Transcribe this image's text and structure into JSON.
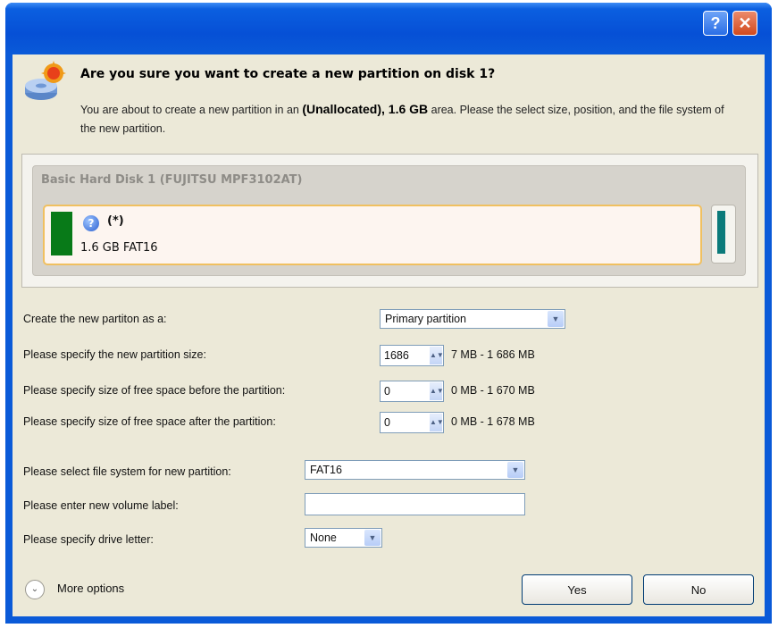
{
  "window": {
    "help_glyph": "?",
    "close_glyph": "✕"
  },
  "header": {
    "title": "Are you sure you want to create a new partition on disk 1?",
    "desc_before": "You are about to create a new partition in an ",
    "desc_bold": "(Unallocated), 1.6 GB",
    "desc_after": " area. Please the select size, position, and the file system of the new partition.",
    "icon": "disk-add-icon"
  },
  "disk": {
    "name": "Basic Hard Disk 1 (FUJITSU MPF3102AT)",
    "partition": {
      "label": "(*)",
      "size_fs": "1.6 GB FAT16",
      "icon": "question-icon"
    }
  },
  "form": {
    "create_as_label": "Create the new partiton as a:",
    "create_as_value": "Primary partition",
    "size_label": "Please specify the new partition size:",
    "size_value": "1686",
    "size_range": "7 MB - 1 686 MB",
    "before_label": "Please specify size of free space before the partition:",
    "before_value": "0",
    "before_range": "0 MB - 1 670 MB",
    "after_label": "Please specify size of free space after the partition:",
    "after_value": "0",
    "after_range": "0 MB - 1 678 MB",
    "fs_label": "Please select file system for new partition:",
    "fs_value": "FAT16",
    "volume_label": "Please enter new volume label:",
    "volume_value": "",
    "drive_label": "Please specify drive letter:",
    "drive_value": "None"
  },
  "footer": {
    "more_options": "More options",
    "yes": "Yes",
    "no": "No"
  },
  "colors": {
    "partition_fat16": "#087a18",
    "free_space": "#0b7a7a",
    "selection_border": "#f0c060",
    "title_bar": "#0a5ad8"
  }
}
